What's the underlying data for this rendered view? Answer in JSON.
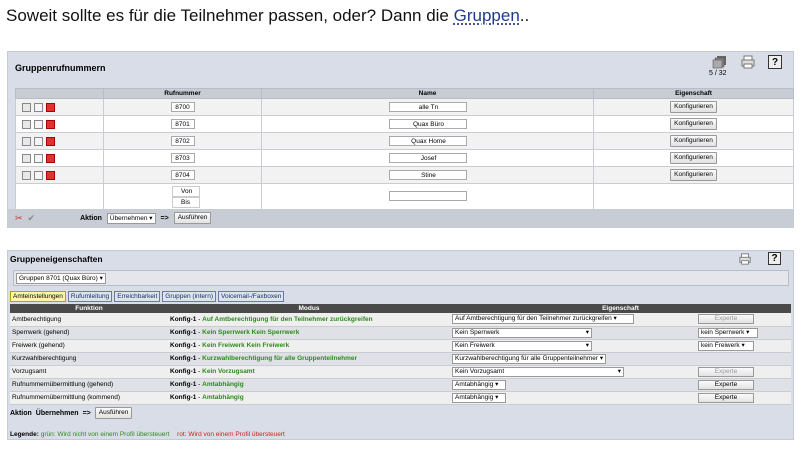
{
  "heading": {
    "text": "Soweit sollte es für die Teilnehmer passen, oder? Dann die ",
    "link": "Gruppen",
    "suffix": ".."
  },
  "panel1": {
    "title": "Gruppenrufnummern",
    "counter": "5 / 32",
    "help_label": "?",
    "columns": [
      "",
      "Rufnummer",
      "Name",
      "Eigenschaft"
    ],
    "rows": [
      {
        "number": "8700",
        "name": "alle Tn",
        "button": "Konfigurieren"
      },
      {
        "number": "8701",
        "name": "Quax Büro",
        "button": "Konfigurieren"
      },
      {
        "number": "8702",
        "name": "Quax Home",
        "button": "Konfigurieren"
      },
      {
        "number": "8703",
        "name": "Josef",
        "button": "Konfigurieren"
      },
      {
        "number": "8704",
        "name": "Stine",
        "button": "Konfigurieren"
      }
    ],
    "range": {
      "from": "Von",
      "to": "Bis"
    },
    "action": {
      "label": "Aktion",
      "select": "Übernehmen",
      "arrow": "=>",
      "button": "Ausführen"
    }
  },
  "panel2": {
    "title": "Gruppeneigenschaften",
    "group_select": "Gruppen 8701 (Quax Büro)",
    "help_label": "?",
    "tabs": [
      "Amteinstellungen",
      "Rufumleitung",
      "Erreichbarkeit",
      "Gruppen (intern)",
      "Voicemail-/Faxboxen"
    ],
    "columns": [
      "Funktion",
      "Modus",
      "Eigenschaft"
    ],
    "rows": [
      {
        "funktion": "Amtberechtigung",
        "konfig": "Konfig-1",
        "modus": "Auf Amtberechtigung für den Teilnehmer zurückgreifen",
        "select": "Auf Amtberechtigung für den Teilnehmer zurückgreifen",
        "button": "Experte",
        "extra": ""
      },
      {
        "funktion": "Sperrwerk (gehend)",
        "konfig": "Konfig-1",
        "modus": "Kein Sperrwerk Kein Sperrwerk",
        "select": "Kein Sperrwerk",
        "button": "",
        "extra": "kein Sperrwerk"
      },
      {
        "funktion": "Freiwerk (gehend)",
        "konfig": "Konfig-1",
        "modus": "Kein Freiwerk Kein Freiwerk",
        "select": "Kein Freiwerk",
        "button": "",
        "extra": "kein Freiwerk"
      },
      {
        "funktion": "Kurzwahlberechtigung",
        "konfig": "Konfig-1",
        "modus": "Kurzwahlberechtigung für alle Gruppenteilnehmer",
        "select": "Kurzwahlberechtigung für alle Gruppenteilnehmer",
        "button": "",
        "extra": ""
      },
      {
        "funktion": "Vorzugsamt",
        "konfig": "Konfig-1",
        "modus": "Kein Vorzugsamt",
        "select": "Kein Vorzugsamt",
        "button": "Experte",
        "extra": ""
      },
      {
        "funktion": "Rufnummernübermittlung (gehend)",
        "konfig": "Konfig-1",
        "modus": "Amtabhängig",
        "select": "Amtabhängig",
        "button": "Experte",
        "extra": ""
      },
      {
        "funktion": "Rufnummernübermittlung (kommend)",
        "konfig": "Konfig-1",
        "modus": "Amtabhängig",
        "select": "Amtabhängig",
        "button": "Experte",
        "extra": ""
      }
    ],
    "action": {
      "label": "Aktion",
      "select": "Übernehmen",
      "arrow": "=>",
      "button": "Ausführen"
    },
    "legend": {
      "label": "Legende:",
      "green": "grün: Wird nicht von einem Profil übersteuert",
      "red": "rot: Wird von einem Profil übersteuert"
    }
  }
}
